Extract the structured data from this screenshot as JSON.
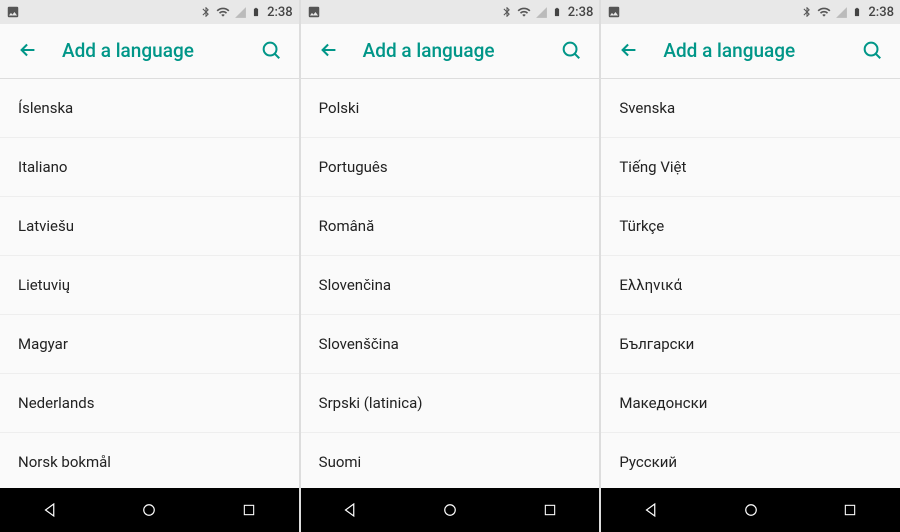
{
  "status": {
    "time": "2:38"
  },
  "appbar": {
    "title": "Add a language"
  },
  "screens": [
    {
      "languages": [
        "Íslenska",
        "Italiano",
        "Latviešu",
        "Lietuvių",
        "Magyar",
        "Nederlands",
        "Norsk bokmål"
      ]
    },
    {
      "languages": [
        "Polski",
        "Português",
        "Română",
        "Slovenčina",
        "Slovenščina",
        "Srpski (latinica)",
        "Suomi"
      ]
    },
    {
      "languages": [
        "Svenska",
        "Tiếng Việt",
        "Türkçe",
        "Ελληνικά",
        "Български",
        "Македонски",
        "Русский"
      ]
    }
  ]
}
